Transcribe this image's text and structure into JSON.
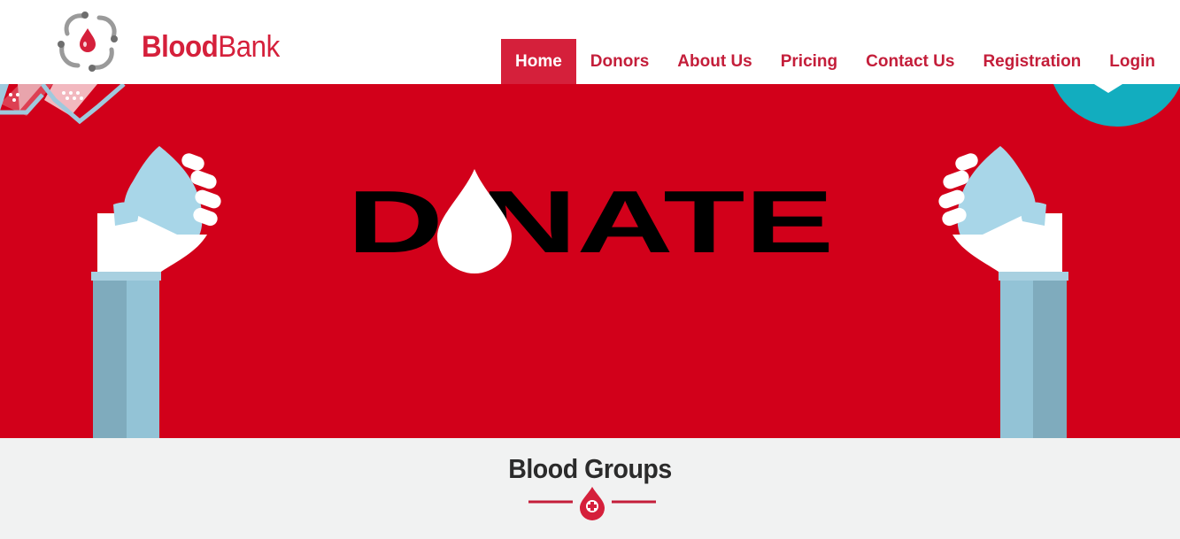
{
  "brand": {
    "bold": "Blood",
    "light": "Bank"
  },
  "nav": {
    "items": [
      {
        "label": "Home",
        "active": true
      },
      {
        "label": "Donors",
        "active": false
      },
      {
        "label": "About Us",
        "active": false
      },
      {
        "label": "Pricing",
        "active": false
      },
      {
        "label": "Contact Us",
        "active": false
      },
      {
        "label": "Registration",
        "active": false
      },
      {
        "label": "Login",
        "active": false
      }
    ]
  },
  "hero": {
    "donate_text": "D NATE",
    "background": "#d2001a"
  },
  "section": {
    "title": "Blood Groups"
  },
  "colors": {
    "accent": "#d5203b",
    "nav_text": "#c41e3a",
    "section_bg": "#f1f2f2"
  },
  "icons": {
    "logo": "blood-drop-hands-icon",
    "divider": "blood-drop-plus-icon"
  }
}
